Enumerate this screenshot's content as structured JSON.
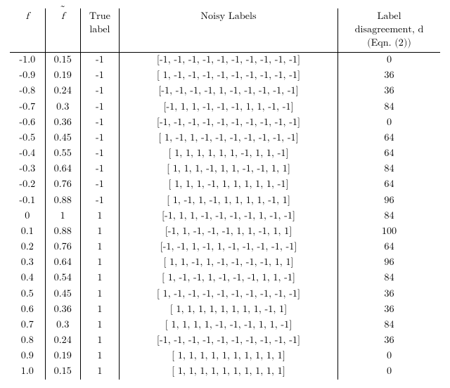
{
  "chart_data": {
    "type": "table",
    "title": "",
    "columns": [
      {
        "key": "f",
        "label_lines": [
          "f"
        ],
        "italic": true,
        "tilde": false
      },
      {
        "key": "ftilde",
        "label_lines": [
          "f"
        ],
        "italic": true,
        "tilde": true
      },
      {
        "key": "true",
        "label_lines": [
          "True",
          "label"
        ],
        "italic": false,
        "tilde": false
      },
      {
        "key": "noisy",
        "label_lines": [
          "Noisy Labels"
        ],
        "italic": false,
        "tilde": false
      },
      {
        "key": "d",
        "label_lines": [
          "Label",
          "disagreement, d",
          "(Eqn. (2))"
        ],
        "italic": false,
        "tilde": false
      }
    ],
    "rows": [
      {
        "f": "-1.0",
        "ftilde": "0.15",
        "true": "-1",
        "noisy": "[-1, -1, -1, -1, -1, -1, -1, -1, -1, -1]",
        "d": "0"
      },
      {
        "f": "-0.9",
        "ftilde": "0.19",
        "true": "-1",
        "noisy": "[ 1, -1, -1, -1, -1, -1, -1, -1, -1, -1]",
        "d": "36"
      },
      {
        "f": "-0.8",
        "ftilde": "0.24",
        "true": "-1",
        "noisy": "[-1, -1, -1, -1, 1, -1, -1, -1, -1, -1]",
        "d": "36"
      },
      {
        "f": "-0.7",
        "ftilde": "0.3",
        "true": "-1",
        "noisy": "[-1, 1, 1, -1, -1, -1, 1, 1, -1, -1]",
        "d": "84"
      },
      {
        "f": "-0.6",
        "ftilde": "0.36",
        "true": "-1",
        "noisy": "[-1, -1, -1, -1, -1, -1, -1, -1, -1, -1]",
        "d": "0"
      },
      {
        "f": "-0.5",
        "ftilde": "0.45",
        "true": "-1",
        "noisy": "[ 1, -1, 1, -1, -1, -1, -1, -1, -1, -1]",
        "d": "64"
      },
      {
        "f": "-0.4",
        "ftilde": "0.55",
        "true": "-1",
        "noisy": "[ 1, 1, 1, 1, 1, 1, -1, 1, 1, -1]",
        "d": "64"
      },
      {
        "f": "-0.3",
        "ftilde": "0.64",
        "true": "-1",
        "noisy": "[ 1, 1, 1, -1, 1, 1, -1, -1, 1, 1]",
        "d": "84"
      },
      {
        "f": "-0.2",
        "ftilde": "0.76",
        "true": "-1",
        "noisy": "[ 1, 1, 1, -1, 1, 1, 1, 1, 1, -1]",
        "d": "64"
      },
      {
        "f": "-0.1",
        "ftilde": "0.88",
        "true": "-1",
        "noisy": "[ 1, -1, 1, -1, 1, 1, 1, 1, -1, 1]",
        "d": "96"
      },
      {
        "f": "0",
        "ftilde": "1",
        "true": "1",
        "noisy": "[-1, 1, 1, -1, -1, -1, -1, 1, -1, -1]",
        "d": "84"
      },
      {
        "f": "0.1",
        "ftilde": "0.88",
        "true": "1",
        "noisy": "[-1, 1, -1, -1, -1, 1, 1, -1, 1, 1]",
        "d": "100"
      },
      {
        "f": "0.2",
        "ftilde": "0.76",
        "true": "1",
        "noisy": "[-1, -1, 1, -1, 1, -1, -1, -1, -1, -1]",
        "d": "64"
      },
      {
        "f": "0.3",
        "ftilde": "0.64",
        "true": "1",
        "noisy": "[ 1, 1, -1, 1, -1, -1, -1, -1, 1, 1]",
        "d": "96"
      },
      {
        "f": "0.4",
        "ftilde": "0.54",
        "true": "1",
        "noisy": "[ 1, -1, -1, 1, -1, -1, -1, 1, 1, -1]",
        "d": "84"
      },
      {
        "f": "0.5",
        "ftilde": "0.45",
        "true": "1",
        "noisy": "[ 1, -1, -1, -1, -1, -1, -1, -1, -1, -1]",
        "d": "36"
      },
      {
        "f": "0.6",
        "ftilde": "0.36",
        "true": "1",
        "noisy": "[ 1, 1, 1, 1, 1, 1, 1, 1, -1, 1]",
        "d": "36"
      },
      {
        "f": "0.7",
        "ftilde": "0.3",
        "true": "1",
        "noisy": "[ 1, 1, 1, 1, -1, -1, -1, 1, 1, -1]",
        "d": "84"
      },
      {
        "f": "0.8",
        "ftilde": "0.24",
        "true": "1",
        "noisy": "[-1, -1, -1, -1, -1, -1, -1, -1, -1, -1]",
        "d": "36"
      },
      {
        "f": "0.9",
        "ftilde": "0.19",
        "true": "1",
        "noisy": "[ 1, 1, 1, 1, 1, 1, 1, 1, 1, 1]",
        "d": "0"
      },
      {
        "f": "1.0",
        "ftilde": "0.15",
        "true": "1",
        "noisy": "[ 1, 1, 1, 1, 1, 1, 1, 1, 1, 1]",
        "d": "0"
      }
    ]
  }
}
